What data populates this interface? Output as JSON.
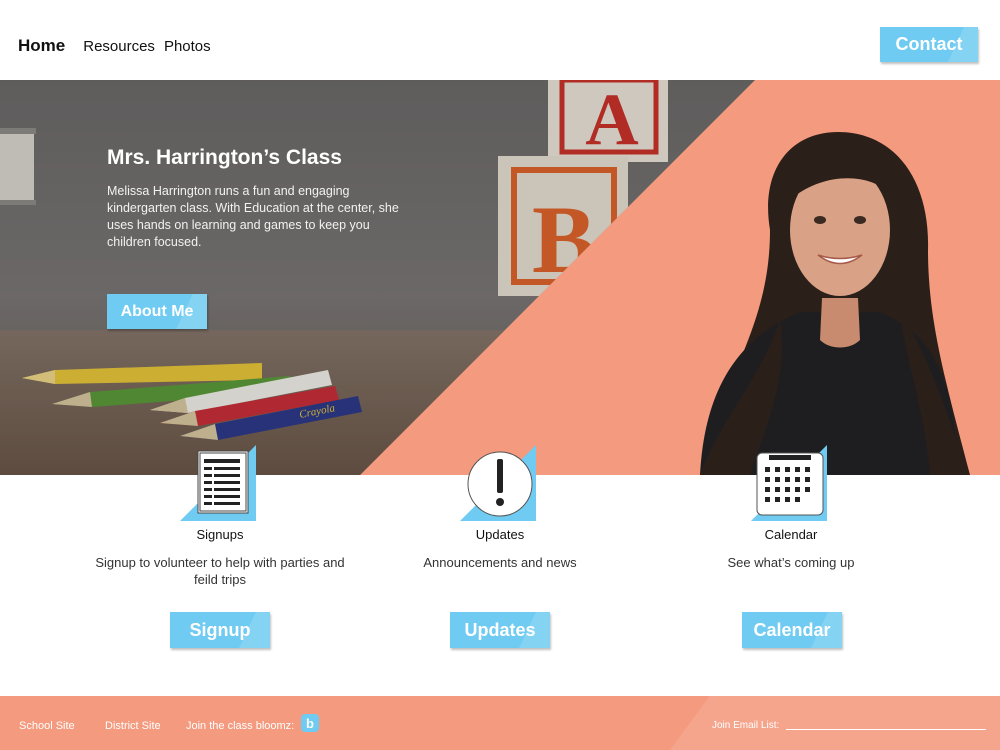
{
  "nav": {
    "home": "Home",
    "resources": "Resources",
    "photos": "Photos",
    "contact": "Contact"
  },
  "hero": {
    "title": "Mrs. Harrington’s Class",
    "description": "Melissa Harrington runs a fun and engaging kindergarten class. With Education at the center, she uses hands on learning and games to keep you children focused.",
    "about_button": "About Me",
    "block_letters": [
      "A",
      "B"
    ],
    "crayon_brand": "Crayola"
  },
  "features": [
    {
      "icon": "document-list-icon",
      "title": "Signups",
      "description": "Signup to volunteer to help with parties and feild trips",
      "button": "Signup"
    },
    {
      "icon": "alert-icon",
      "title": "Updates",
      "description": "Announcements and news",
      "button": "Updates"
    },
    {
      "icon": "calendar-icon",
      "title": "Calendar",
      "description": "See what’s coming up",
      "button": "Calendar"
    }
  ],
  "footer": {
    "school_site": "School Site",
    "district_site": "District Site",
    "bloomz": "Join the class bloomz:",
    "bloomz_badge": "b",
    "email_label": "Join Email List:",
    "email_value": ""
  },
  "colors": {
    "accent_blue": "#6fcbf1",
    "coral": "#f49a7e",
    "white": "#ffffff"
  }
}
